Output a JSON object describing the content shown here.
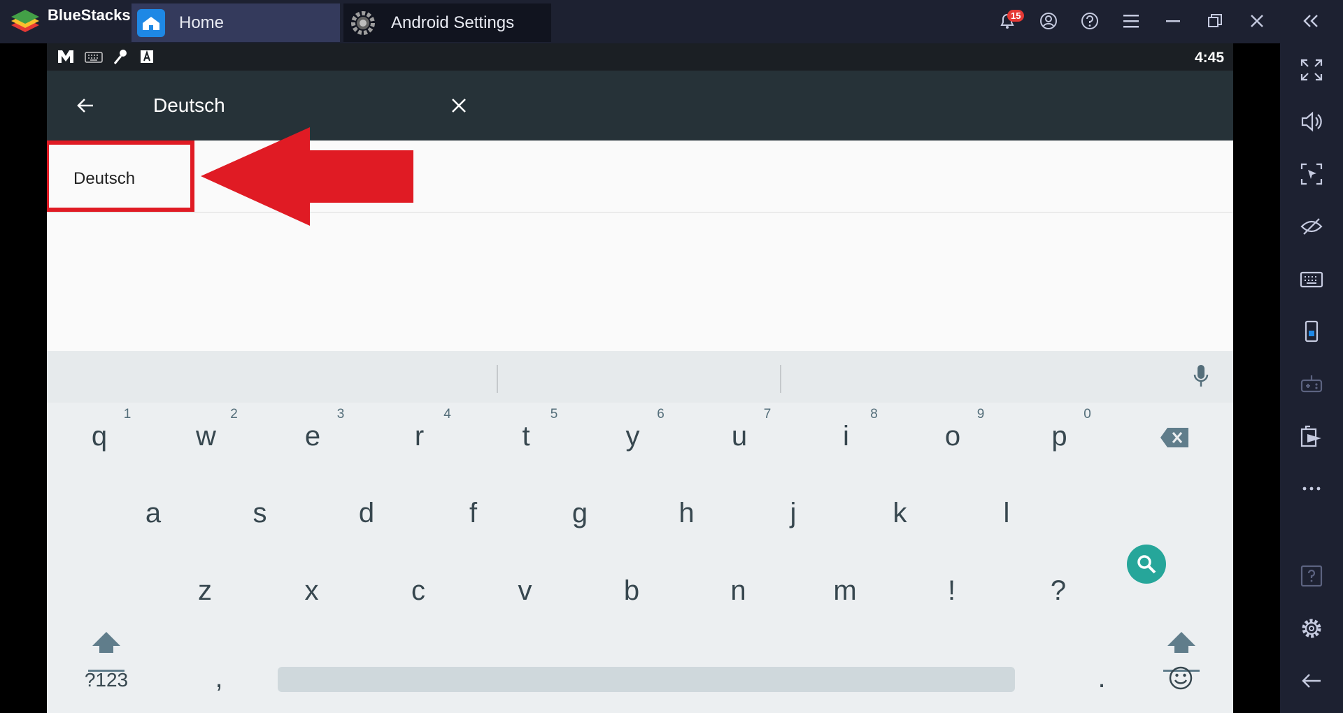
{
  "app": {
    "brand": "BlueStacks",
    "notification_count": "15"
  },
  "tabs": [
    {
      "label": "Home"
    },
    {
      "label": "Android Settings"
    }
  ],
  "status_bar": {
    "time": "4:45"
  },
  "search": {
    "query": "Deutsch"
  },
  "results": [
    {
      "label": "Deutsch"
    }
  ],
  "keyboard": {
    "row1": [
      {
        "k": "q",
        "h": "1"
      },
      {
        "k": "w",
        "h": "2"
      },
      {
        "k": "e",
        "h": "3"
      },
      {
        "k": "r",
        "h": "4"
      },
      {
        "k": "t",
        "h": "5"
      },
      {
        "k": "y",
        "h": "6"
      },
      {
        "k": "u",
        "h": "7"
      },
      {
        "k": "i",
        "h": "8"
      },
      {
        "k": "o",
        "h": "9"
      },
      {
        "k": "p",
        "h": "0"
      }
    ],
    "row2": [
      "a",
      "s",
      "d",
      "f",
      "g",
      "h",
      "j",
      "k",
      "l"
    ],
    "row3": [
      "z",
      "x",
      "c",
      "v",
      "b",
      "n",
      "m",
      "!",
      "?"
    ],
    "symbols_key": "?123",
    "comma": ",",
    "period": "."
  },
  "colors": {
    "accent_search": "#26a69a",
    "highlight": "#e01b24",
    "appbar": "#263238"
  },
  "icons": {
    "titlebar": [
      "bell-icon",
      "account-icon",
      "help-icon",
      "menu-icon",
      "minimize-icon",
      "restore-icon",
      "close-icon",
      "collapse-sidebar-icon"
    ],
    "sidebar": [
      "fullscreen-icon",
      "volume-icon",
      "pointer-lock-icon",
      "eye-off-icon",
      "keyboard-icon",
      "screen-rotate-icon",
      "gamepad-icon",
      "media-import-icon",
      "more-icon",
      "help-icon",
      "settings-icon",
      "back-icon"
    ]
  }
}
